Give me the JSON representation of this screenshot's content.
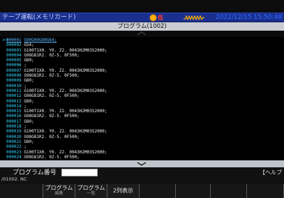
{
  "status_bar": {
    "mode_title": "テープ運転(メモリカード)",
    "warning_text": "低",
    "datetime": "2022/12/15 15:50:48"
  },
  "program_header": {
    "title": "プログラム(1002)"
  },
  "editor": {
    "cursor_marker": ">>",
    "lines": [
      {
        "num": "000001",
        "text": "G90G00G80G64;"
      },
      {
        "num": "000002",
        "text": "G54;"
      },
      {
        "num": "000003",
        "text": "G100T1X0. Y0. Z2. 0043H2M03S2000;"
      },
      {
        "num": "000004",
        "text": "G98G81R2. 0Z-5. 0F500;"
      },
      {
        "num": "000005",
        "text": "G80;"
      },
      {
        "num": "000006",
        "text": ";"
      },
      {
        "num": "000007",
        "text": "G100T1X0. Y0. Z2. 0043H2M03S2000;"
      },
      {
        "num": "000008",
        "text": "G98G81R2. 0Z-5. 0F500;"
      },
      {
        "num": "000009",
        "text": "G80;"
      },
      {
        "num": "000010",
        "text": ";"
      },
      {
        "num": "000011",
        "text": "G100T1X0. Y0. Z2. 0043H2M03S2000;"
      },
      {
        "num": "000012",
        "text": "G98G81R2. 0Z-5. 0F500;"
      },
      {
        "num": "000013",
        "text": "G80;"
      },
      {
        "num": "000014",
        "text": ";"
      },
      {
        "num": "000015",
        "text": "G100T1X0. Y0. Z2. 0043H2M03S2000;"
      },
      {
        "num": "000016",
        "text": "G98G81R2. 0Z-5. 0F500;"
      },
      {
        "num": "000017",
        "text": "G80;"
      },
      {
        "num": "000018",
        "text": ";"
      },
      {
        "num": "000019",
        "text": "G100T1X0. Y0. Z2. 0043H2M03S2000;"
      },
      {
        "num": "000020",
        "text": "G98G81R2. 0Z-5. 0F500;"
      },
      {
        "num": "000021",
        "text": "G80;"
      },
      {
        "num": "000022",
        "text": ";"
      },
      {
        "num": "000023",
        "text": "G100T1X0. Y0. Z2. 0043H2M03S2000;"
      },
      {
        "num": "000024",
        "text": "G98G81R2. 0Z-5. 0F500;"
      }
    ]
  },
  "input_area": {
    "prog_num_label": "プログラム番号",
    "prog_num_value": "",
    "help_label": "【ヘルプ",
    "path_text": "/01002. NC"
  },
  "softkeys": [
    {
      "label": "",
      "sub": ""
    },
    {
      "label": "プログラム",
      "sub": "編集"
    },
    {
      "label": "プログラム",
      "sub": "一覧"
    },
    {
      "label": "2列表示",
      "sub": ""
    },
    {
      "label": "",
      "sub": ""
    },
    {
      "label": "",
      "sub": ""
    },
    {
      "label": "",
      "sub": ""
    },
    {
      "label": "",
      "sub": ""
    }
  ],
  "colors": {
    "status_bar_bg": "#1a2f8e",
    "datetime": "#2f6eff",
    "line_number": "#37d7ff",
    "code_text": "#f2f2f2",
    "warning": "#ffb000",
    "alarm": "#ff3b2f"
  },
  "icons": {
    "warning": "warning-lamp-icon",
    "alarm": "alarm-waveform-icon",
    "scroll_up": "chevron-up-icon",
    "scroll_down": "chevron-down-icon"
  }
}
